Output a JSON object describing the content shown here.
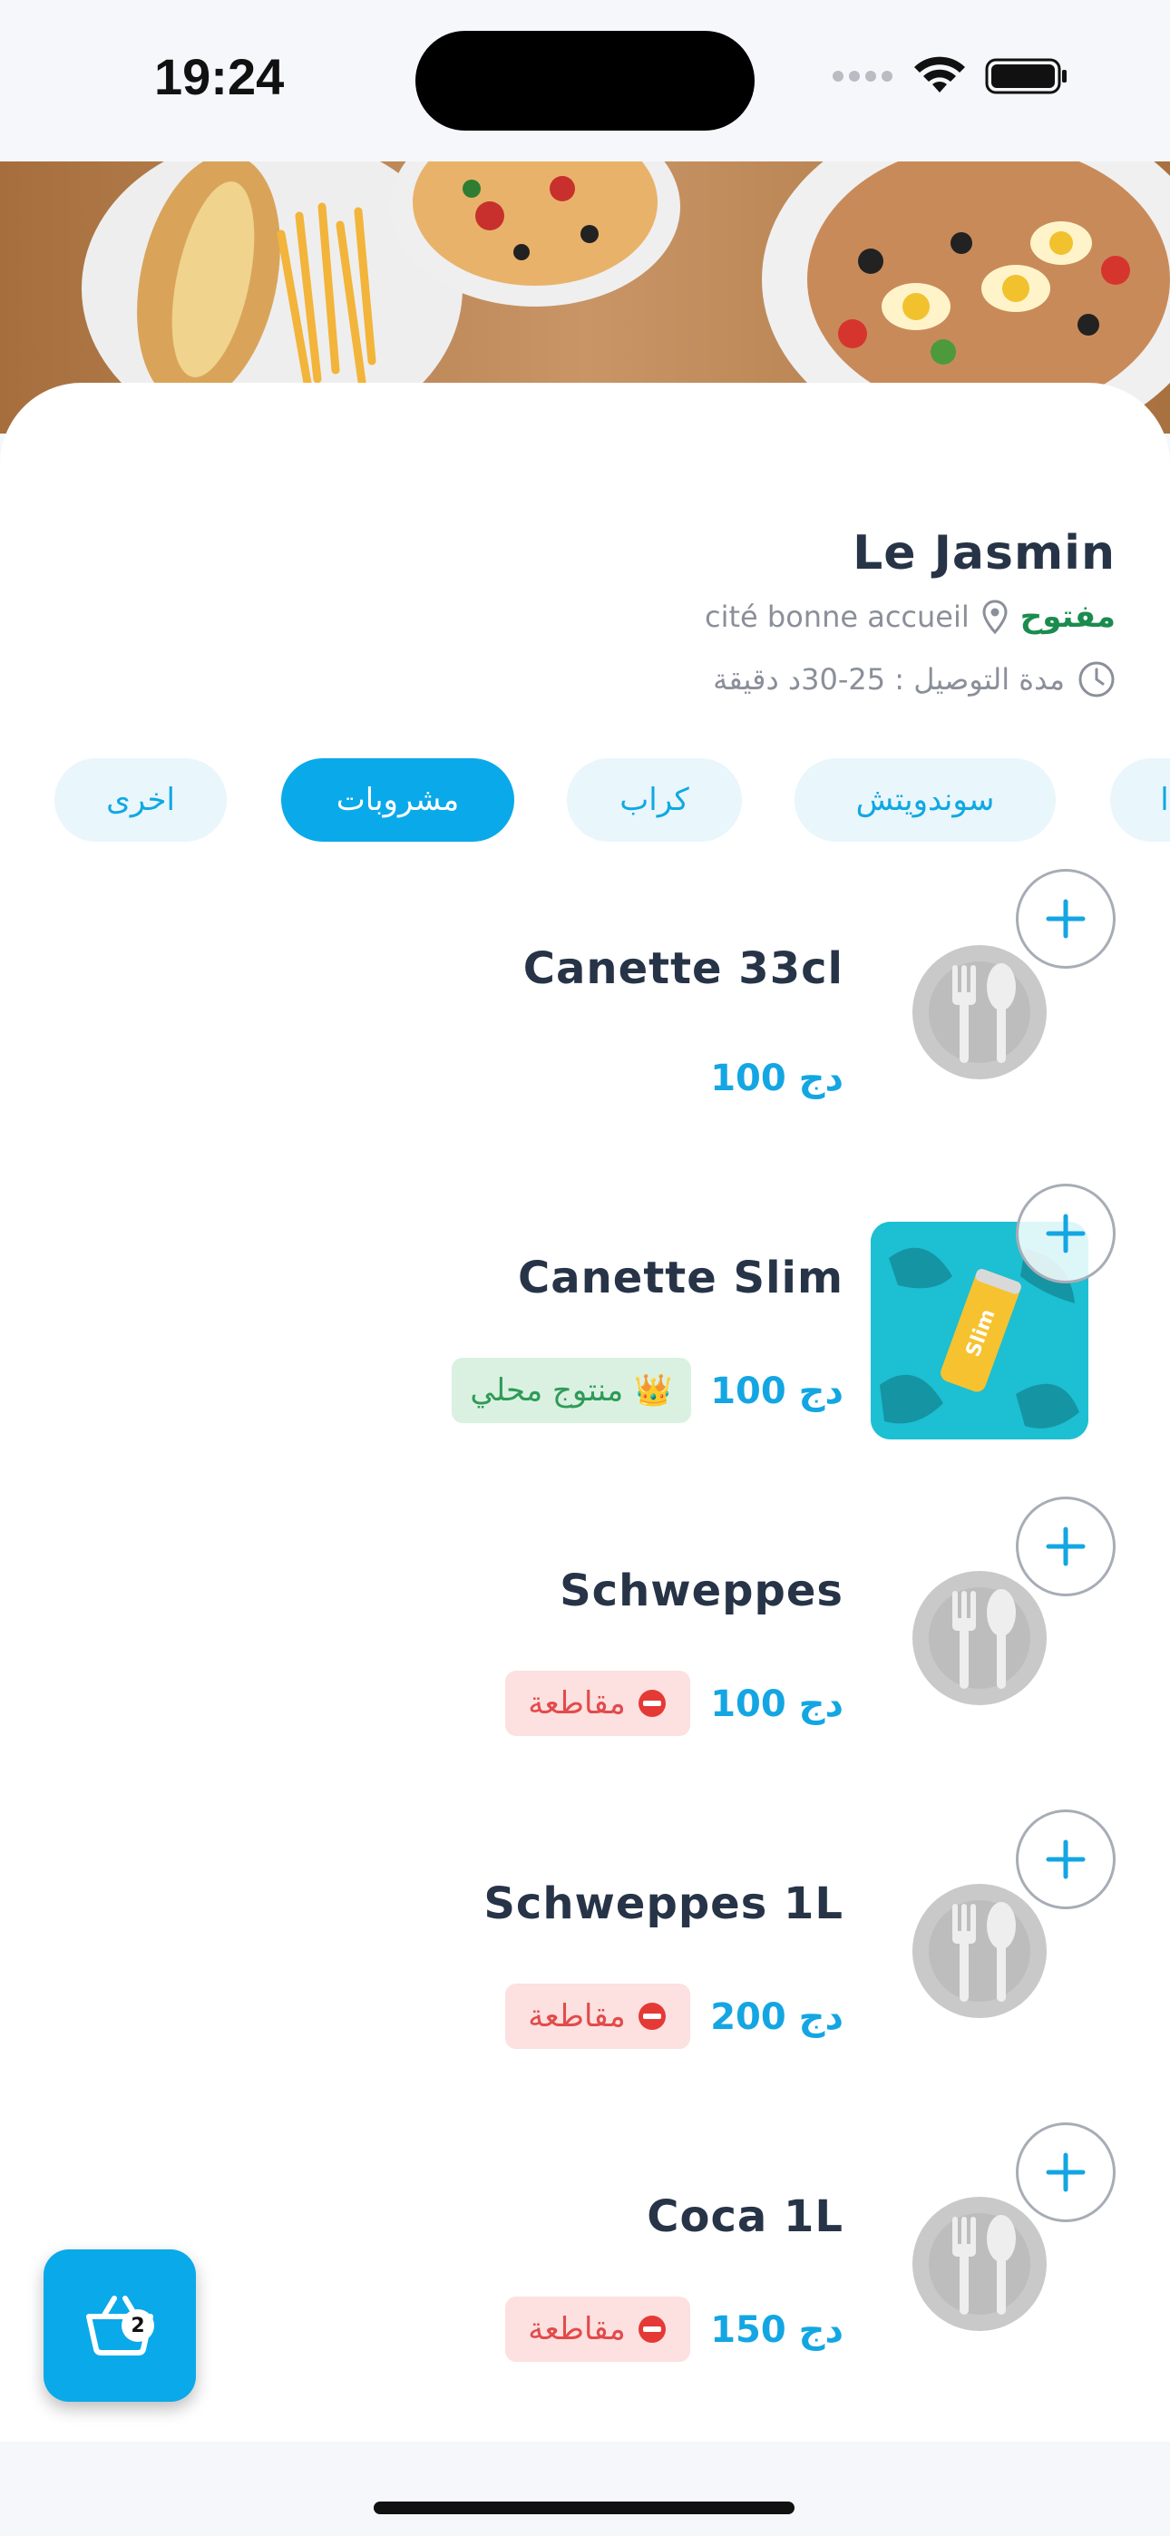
{
  "status": {
    "time": "19:24"
  },
  "restaurant": {
    "name": "Le Jasmin",
    "status": "مفتوح",
    "address": "cité bonne accueil",
    "delivery": "مدة التوصيل : 25-30د دقيقة"
  },
  "tabs": [
    {
      "label": "ا",
      "active": false
    },
    {
      "label": "سوندويتش",
      "active": false
    },
    {
      "label": "كراب",
      "active": false
    },
    {
      "label": "مشروبات",
      "active": true
    },
    {
      "label": "اخرى",
      "active": false
    }
  ],
  "items": [
    {
      "name": "Canette 33cl",
      "price": "100 دج",
      "badge": null,
      "image": "placeholder-plate"
    },
    {
      "name": "Canette Slim",
      "price": "100 دج",
      "badge": {
        "type": "local",
        "text": "منتوج محلي",
        "icon": "crown-icon"
      },
      "image": "product-photo"
    },
    {
      "name": "Schweppes",
      "price": "100 دج",
      "badge": {
        "type": "boycott",
        "text": "مقاطعة",
        "icon": "no-entry-icon"
      },
      "image": "placeholder-plate"
    },
    {
      "name": "Schweppes 1L",
      "price": "200 دج",
      "badge": {
        "type": "boycott",
        "text": "مقاطعة",
        "icon": "no-entry-icon"
      },
      "image": "placeholder-plate"
    },
    {
      "name": "Coca 1L",
      "price": "150 دج",
      "badge": {
        "type": "boycott",
        "text": "مقاطعة",
        "icon": "no-entry-icon"
      },
      "image": "placeholder-plate"
    }
  ],
  "cart": {
    "count": "2"
  },
  "colors": {
    "accent": "#0aa9ea",
    "open": "#1a8c4e",
    "boycott": "#e24b4b",
    "local": "#2e9b58"
  }
}
